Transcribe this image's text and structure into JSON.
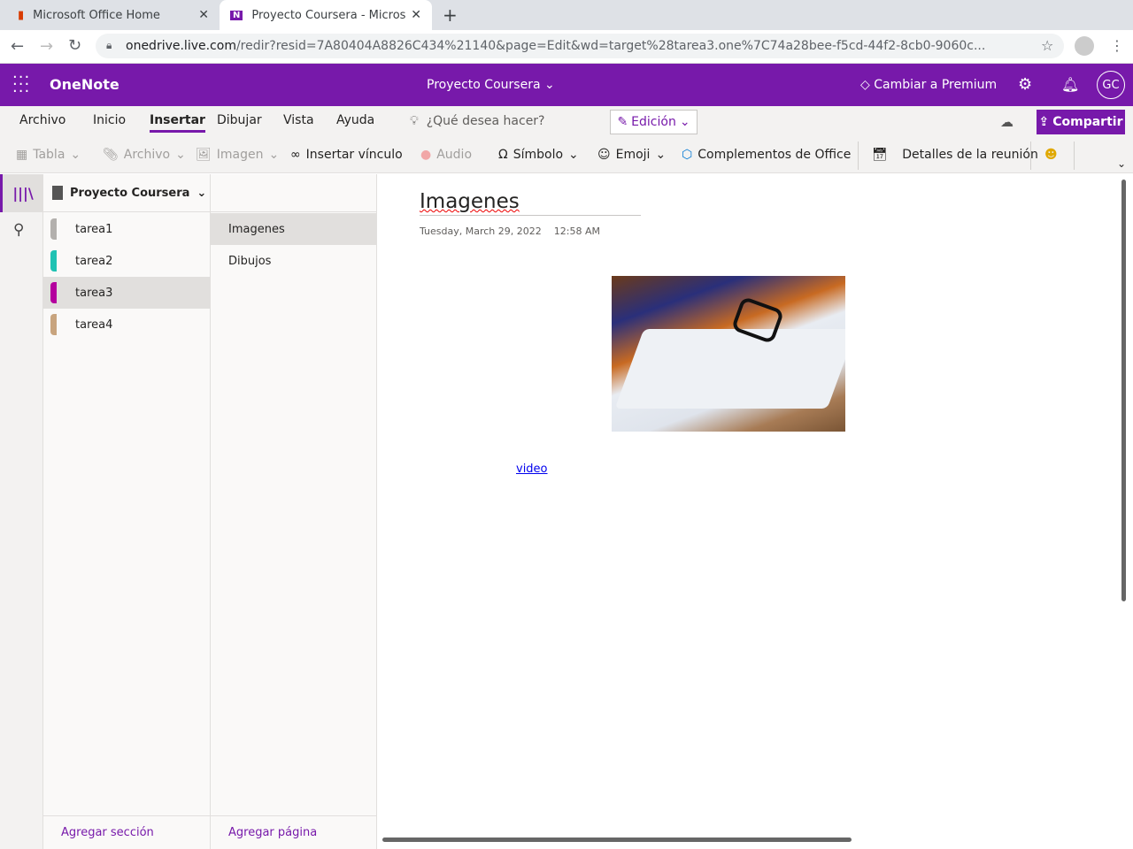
{
  "browser": {
    "tabs": [
      {
        "title": "Microsoft Office Home"
      },
      {
        "title": "Proyecto Coursera - Micros"
      }
    ],
    "url_host": "onedrive.live.com",
    "url_rest": "/redir?resid=7A80404A8826C434%21140&page=Edit&wd=target%28tarea3.one%7C74a28bee-f5cd-44f2-8cb0-9060c..."
  },
  "app": {
    "name": "OneNote",
    "notebook_title": "Proyecto Coursera",
    "premium": "Cambiar a Premium",
    "avatar": "GC"
  },
  "ribbon": {
    "tabs": [
      "Archivo",
      "Inicio",
      "Insertar",
      "Dibujar",
      "Vista",
      "Ayuda"
    ],
    "search": "¿Qué desea hacer?",
    "mode": "Edición",
    "share": "Compartir"
  },
  "toolbar": {
    "table": "Tabla",
    "file": "Archivo",
    "image": "Imagen",
    "link": "Insertar vínculo",
    "audio": "Audio",
    "symbol": "Símbolo",
    "emoji": "Emoji",
    "addins": "Complementos de Office",
    "meeting": "Detalles de la reunión"
  },
  "nav": {
    "notebook": "Proyecto Coursera",
    "sections": [
      {
        "name": "tarea1",
        "color": "#b3b0ad"
      },
      {
        "name": "tarea2",
        "color": "#1fc2b3"
      },
      {
        "name": "tarea3",
        "color": "#b4009e"
      },
      {
        "name": "tarea4",
        "color": "#c8a47e"
      }
    ],
    "pages": [
      "Imagenes",
      "Dibujos"
    ],
    "add_section": "Agregar sección",
    "add_page": "Agregar página"
  },
  "page": {
    "title": "Imagenes",
    "date": "Tuesday, March 29, 2022",
    "time": "12:58 AM",
    "link": "video"
  }
}
